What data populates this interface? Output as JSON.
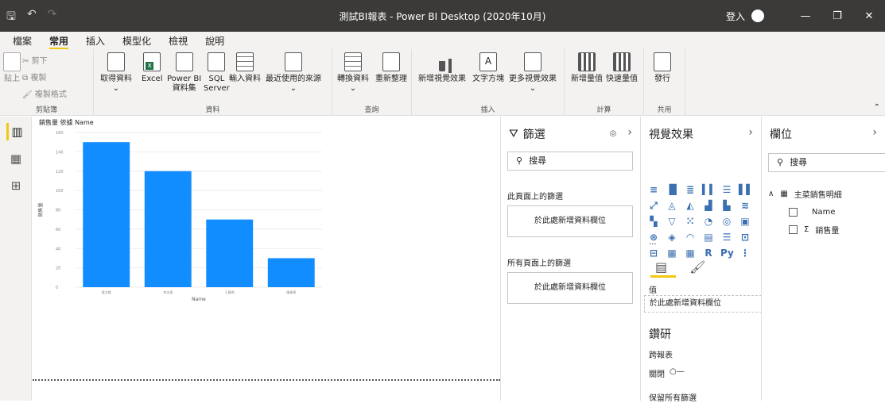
{
  "window": {
    "title": "測試BI報表 - Power BI Desktop (2020年10月)",
    "signin": "登入"
  },
  "menu": {
    "items": [
      "檔案",
      "常用",
      "插入",
      "模型化",
      "檢視",
      "說明"
    ],
    "active": "常用"
  },
  "ribbon": {
    "clipboard": {
      "paste": "貼上",
      "cut": "剪下",
      "copy": "複製",
      "format_painter": "複製格式",
      "label": "剪貼簿"
    },
    "data": {
      "get_data": "取得資料",
      "excel": "Excel",
      "pbi_datasets_1": "Power BI",
      "pbi_datasets_2": "資料集",
      "sql_1": "SQL",
      "sql_2": "Server",
      "enter_data": "輸入資料",
      "recent": "最近使用的來源",
      "label": "資料"
    },
    "queries": {
      "transform": "轉換資料",
      "refresh": "重新整理",
      "label": "查詢"
    },
    "insert": {
      "new_visual": "新增視覺效果",
      "text_box": "文字方塊",
      "more_visuals": "更多視覺效果",
      "label": "插入"
    },
    "calc": {
      "new_measure": "新增量值",
      "quick_measure": "快速量值",
      "label": "計算"
    },
    "share": {
      "publish": "發行",
      "label": "共用"
    }
  },
  "chart_data": {
    "type": "bar",
    "title": "銷售量 依據 Name",
    "xlabel": "Name",
    "ylabel": "銷售量",
    "ylim": [
      0,
      160
    ],
    "yticks": [
      "0",
      "20",
      "40",
      "60",
      "80",
      "100",
      "120",
      "140",
      "160"
    ],
    "categories": [
      "黃文雄",
      "李志偉",
      "王曉明",
      "陳美華"
    ],
    "values": [
      150,
      120,
      70,
      30
    ],
    "color": "#118dff"
  },
  "filters": {
    "title": "篩選",
    "search_placeholder": "搜尋",
    "this_page": "此頁面上的篩選",
    "all_pages": "所有頁面上的篩選",
    "add_field": "於此處新增資料欄位",
    "dots": "..."
  },
  "viz": {
    "title": "視覺效果",
    "values_label": "值",
    "add_field": "於此處新增資料欄位",
    "drill": "鑽研",
    "cross_report": "跨報表",
    "off": "關閉",
    "keep_filters": "保留所有篩選",
    "more": "...",
    "icons": [
      "堆疊橫條圖",
      "堆疊直條圖",
      "群組橫條圖",
      "群組直條圖",
      "百分比橫條圖",
      "百分比直條圖",
      "折線圖",
      "區域圖",
      "堆疊區域圖",
      "折線群組直條圖",
      "折線堆疊直條圖",
      "緞帶圖",
      "瀑布圖",
      "漏斗圖",
      "散佈圖",
      "圓形圖",
      "環圈圖",
      "矩形式樹狀結構圖",
      "地圖",
      "區域分布圖",
      "量測計",
      "卡片",
      "多列卡片",
      "KPI",
      "交叉分析篩選器",
      "資料表",
      "矩陣",
      "R",
      "Py",
      "分解樹"
    ]
  },
  "fields": {
    "title": "欄位",
    "search_placeholder": "搜尋",
    "table": "主菜銷售明細",
    "field1": "Name",
    "field2": "銷售量",
    "sigma": "Σ"
  }
}
